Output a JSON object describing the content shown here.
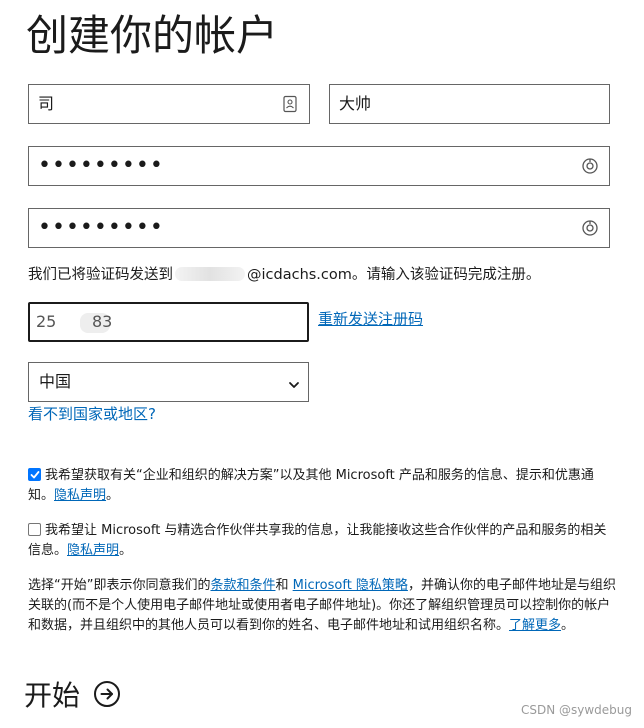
{
  "page": {
    "title": "创建你的帐户"
  },
  "name_fields": {
    "first_name": "司",
    "last_name": "大帅",
    "first_icon": "contact-card-icon"
  },
  "password_fields": {
    "password": "•••••••••",
    "confirm_password": "•••••••••",
    "reveal_icon": "eye-reveal-icon"
  },
  "verification": {
    "message_prefix": "我们已将验证码发送到",
    "message_email_suffix": "@icdachs.com。请输入该验证码完成注册。",
    "code_visible_start": "25",
    "code_visible_end": "83",
    "resend_link": "重新发送注册码"
  },
  "country": {
    "selected": "中国",
    "help_link": "看不到国家或地区?"
  },
  "consents": {
    "marketing_text": "我希望获取有关“企业和组织的解决方案”以及其他 Microsoft 产品和服务的信息、提示和优惠通知。",
    "marketing_link": "隐私声明",
    "marketing_checked": true,
    "partner_text": "我希望让 Microsoft 与精选合作伙伴共享我的信息，让我能接收这些合作伙伴的产品和服务的相关信息。",
    "partner_link": "隐私声明",
    "partner_checked": false
  },
  "terms": {
    "part1": "选择“开始”即表示你同意我们的",
    "terms_link": "条款和条件",
    "part2": "和 ",
    "privacy_link": "Microsoft 隐私策略",
    "part3": "，并确认你的电子邮件地址是与组织关联的(而不是个人使用电子邮件地址或使用者电子邮件地址)。你还了解组织管理员可以控制你的帐户和数据，并且组织中的其他人员可以看到你的姓名、电子邮件地址和试用组织名称。",
    "learn_more_link": "了解更多"
  },
  "start": {
    "label": "开始",
    "icon": "arrow-right-circle-icon"
  },
  "watermark": "CSDN @sywdebug",
  "colors": {
    "link": "#0067b8",
    "checkbox": "#0075ff",
    "text": "#1b1b1b"
  }
}
